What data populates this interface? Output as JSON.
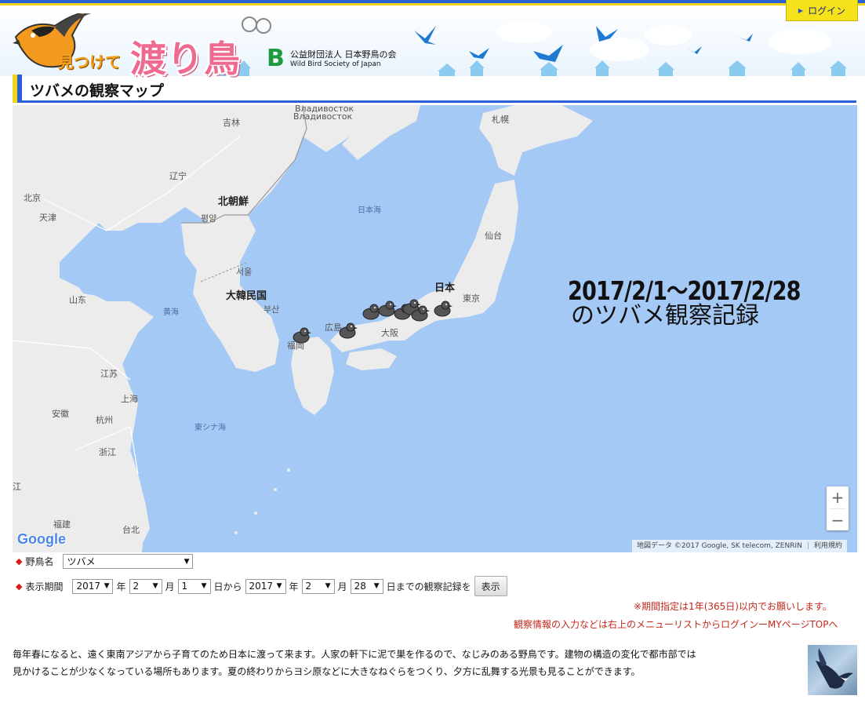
{
  "header": {
    "login_label": "ログイン",
    "logo_text": "渡り鳥",
    "logo_sub": "見つけて",
    "org_mark": "B",
    "org_name_jp": "公益財団法人 日本野鳥の会",
    "org_name_en": "Wild Bird Society of Japan",
    "page_title": "ツバメの観察マップ"
  },
  "map": {
    "overlay_date_range": "2017/2/1～2017/2/28",
    "overlay_caption": "のツバメ観察記録",
    "labels": {
      "vladivostok_ru": "Владивосток",
      "vladivostok_ru2": "Владивосток",
      "jilin": "吉林",
      "sapporo": "札幌",
      "liaoning": "辽宁",
      "beijing": "北京",
      "tianjin": "天津",
      "north_korea": "北朝鮮",
      "pyongyang": "평양",
      "sea_of_japan": "日本海",
      "sendai": "仙台",
      "seoul": "서울",
      "south_korea": "大韓民国",
      "japan": "日本",
      "tokyo": "東京",
      "yellow_sea": "黄海",
      "busan": "부산",
      "shandong": "山东",
      "hiroshima": "広島",
      "osaka": "大阪",
      "fukuoka": "福岡",
      "jiangsu": "江苏",
      "shanghai": "上海",
      "anhui": "安徽",
      "hangzhou": "杭州",
      "east_china_sea": "東シナ海",
      "zhejiang": "浙江",
      "jiangxi": "江",
      "fujian": "福建",
      "taipei": "台北"
    },
    "zoom_in": "+",
    "zoom_out": "−",
    "google": "Google",
    "attribution": "地図データ ©2017 Google, SK telecom, ZENRIN",
    "terms": "利用規約",
    "marker_color": "#555555"
  },
  "form": {
    "bird_label": "野鳥名",
    "bird_value": "ツバメ",
    "period_label": "表示期間",
    "from_year": "2017",
    "year_unit": "年",
    "from_month": "2",
    "month_unit": "月",
    "from_day": "1",
    "from_suffix": "日から",
    "to_year": "2017",
    "to_month": "2",
    "to_day": "28",
    "to_suffix": "日までの観察記録を",
    "show_button": "表示",
    "note_period": "※期間指定は1年(365日)以内でお願いします。",
    "note_login": "観察情報の入力などは右上のメニューリストからログインーMYページTOPへ"
  },
  "description": {
    "line1": "毎年春になると、遠く東南アジアから子育てのため日本に渡って来ます。人家の軒下に泥で巣を作るので、なじみのある野鳥です。建物の構造の変化で都市部では",
    "line2": "見かけることが少なくなっている場所もあります。夏の終わりからヨシ原などに大きなねぐらをつくり、夕方に乱舞する光景も見ることができます。"
  },
  "colors": {
    "accent_blue": "#2a5fd8",
    "accent_yellow": "#f2d21c",
    "sea": "#a5c9f5",
    "land": "#ececec",
    "note_red": "#c4281c"
  }
}
